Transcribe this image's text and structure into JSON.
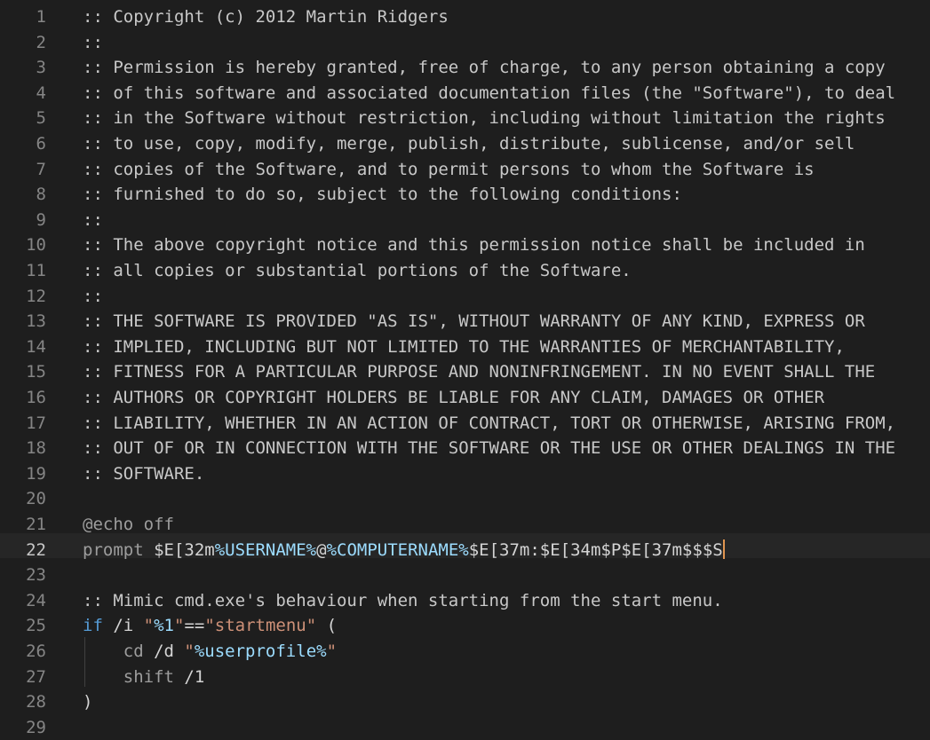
{
  "editor": {
    "active_line": 22,
    "lines": [
      {
        "num": "1",
        "tokens": [
          {
            "t": ":: Copyright (c) 2012 Martin Ridgers",
            "c": "t-cmt"
          }
        ]
      },
      {
        "num": "2",
        "tokens": [
          {
            "t": "::",
            "c": "t-cmt"
          }
        ]
      },
      {
        "num": "3",
        "tokens": [
          {
            "t": ":: Permission is hereby granted, free of charge, to any person obtaining a copy",
            "c": "t-cmt"
          }
        ]
      },
      {
        "num": "4",
        "tokens": [
          {
            "t": ":: of this software and associated documentation files (the \"Software\"), to deal",
            "c": "t-cmt"
          }
        ]
      },
      {
        "num": "5",
        "tokens": [
          {
            "t": ":: in the Software without restriction, including without limitation the rights",
            "c": "t-cmt"
          }
        ]
      },
      {
        "num": "6",
        "tokens": [
          {
            "t": ":: to use, copy, modify, merge, publish, distribute, sublicense, and/or sell",
            "c": "t-cmt"
          }
        ]
      },
      {
        "num": "7",
        "tokens": [
          {
            "t": ":: copies of the Software, and to permit persons to whom the Software is",
            "c": "t-cmt"
          }
        ]
      },
      {
        "num": "8",
        "tokens": [
          {
            "t": ":: furnished to do so, subject to the following conditions:",
            "c": "t-cmt"
          }
        ]
      },
      {
        "num": "9",
        "tokens": [
          {
            "t": "::",
            "c": "t-cmt"
          }
        ]
      },
      {
        "num": "10",
        "tokens": [
          {
            "t": ":: The above copyright notice and this permission notice shall be included in",
            "c": "t-cmt"
          }
        ]
      },
      {
        "num": "11",
        "tokens": [
          {
            "t": ":: all copies or substantial portions of the Software.",
            "c": "t-cmt"
          }
        ]
      },
      {
        "num": "12",
        "tokens": [
          {
            "t": "::",
            "c": "t-cmt"
          }
        ]
      },
      {
        "num": "13",
        "tokens": [
          {
            "t": ":: THE SOFTWARE IS PROVIDED \"AS IS\", WITHOUT WARRANTY OF ANY KIND, EXPRESS OR",
            "c": "t-cmt"
          }
        ]
      },
      {
        "num": "14",
        "tokens": [
          {
            "t": ":: IMPLIED, INCLUDING BUT NOT LIMITED TO THE WARRANTIES OF MERCHANTABILITY,",
            "c": "t-cmt"
          }
        ]
      },
      {
        "num": "15",
        "tokens": [
          {
            "t": ":: FITNESS FOR A PARTICULAR PURPOSE AND NONINFRINGEMENT. IN NO EVENT SHALL THE",
            "c": "t-cmt"
          }
        ]
      },
      {
        "num": "16",
        "tokens": [
          {
            "t": ":: AUTHORS OR COPYRIGHT HOLDERS BE LIABLE FOR ANY CLAIM, DAMAGES OR OTHER",
            "c": "t-cmt"
          }
        ]
      },
      {
        "num": "17",
        "tokens": [
          {
            "t": ":: LIABILITY, WHETHER IN AN ACTION OF CONTRACT, TORT OR OTHERWISE, ARISING FROM,",
            "c": "t-cmt"
          }
        ]
      },
      {
        "num": "18",
        "tokens": [
          {
            "t": ":: OUT OF OR IN CONNECTION WITH THE SOFTWARE OR THE USE OR OTHER DEALINGS IN THE",
            "c": "t-cmt"
          }
        ]
      },
      {
        "num": "19",
        "tokens": [
          {
            "t": ":: SOFTWARE.",
            "c": "t-cmt"
          }
        ]
      },
      {
        "num": "20",
        "tokens": []
      },
      {
        "num": "21",
        "tokens": [
          {
            "t": "@echo off",
            "c": "t-cmd"
          }
        ]
      },
      {
        "num": "22",
        "tokens": [
          {
            "t": "prompt ",
            "c": "t-cmd"
          },
          {
            "t": "$E[32m",
            "c": "t-esc"
          },
          {
            "t": "%USERNAME%",
            "c": "t-var"
          },
          {
            "t": "@",
            "c": "t-esc"
          },
          {
            "t": "%COMPUTERNAME%",
            "c": "t-var"
          },
          {
            "t": "$E[37m:$E[34m$P$E[37m$$$S",
            "c": "t-esc"
          }
        ]
      },
      {
        "num": "23",
        "tokens": []
      },
      {
        "num": "24",
        "tokens": [
          {
            "t": ":: Mimic cmd.exe's behaviour when starting from the start menu.",
            "c": "t-cmt"
          }
        ]
      },
      {
        "num": "25",
        "tokens": [
          {
            "t": "if",
            "c": "t-kw"
          },
          {
            "t": " /i ",
            "c": "t-esc"
          },
          {
            "t": "\"",
            "c": "t-str"
          },
          {
            "t": "%1",
            "c": "t-var"
          },
          {
            "t": "\"",
            "c": "t-str"
          },
          {
            "t": "==",
            "c": "t-eq"
          },
          {
            "t": "\"startmenu\"",
            "c": "t-str"
          },
          {
            "t": " (",
            "c": "t-esc"
          }
        ]
      },
      {
        "num": "26",
        "tokens": [
          {
            "t": "    cd",
            "c": "t-cmd"
          },
          {
            "t": " /d ",
            "c": "t-esc"
          },
          {
            "t": "\"",
            "c": "t-str"
          },
          {
            "t": "%userprofile%",
            "c": "t-var"
          },
          {
            "t": "\"",
            "c": "t-str"
          }
        ]
      },
      {
        "num": "27",
        "tokens": [
          {
            "t": "    shift",
            "c": "t-cmd"
          },
          {
            "t": " /1",
            "c": "t-esc"
          }
        ]
      },
      {
        "num": "28",
        "tokens": [
          {
            "t": ")",
            "c": "t-esc"
          }
        ]
      },
      {
        "num": "29",
        "tokens": []
      }
    ]
  }
}
